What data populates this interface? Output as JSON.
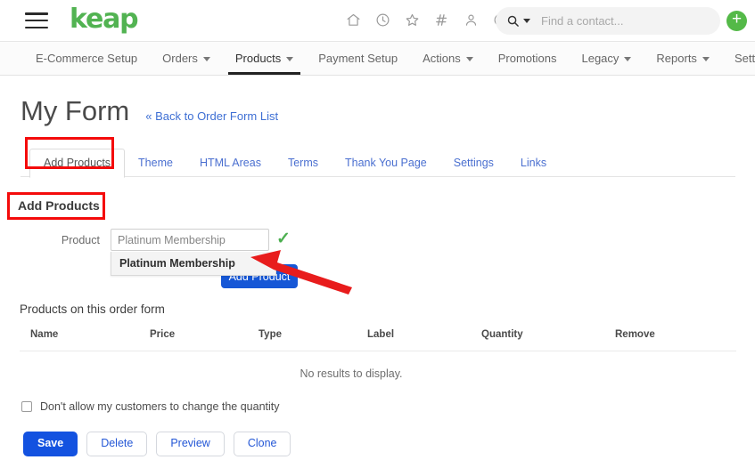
{
  "header": {
    "brand": "keap",
    "menu_icon": "hamburger-icon",
    "icons": [
      {
        "name": "home-icon"
      },
      {
        "name": "history-clock-icon"
      },
      {
        "name": "favorites-star-icon"
      },
      {
        "name": "shortcuts-icon"
      },
      {
        "name": "contacts-person-icon"
      },
      {
        "name": "help-question-icon"
      }
    ],
    "search": {
      "placeholder": "Find a contact...",
      "value": "",
      "icon": "search-icon",
      "dropdown_icon": "caret-down-icon"
    },
    "add_button": {
      "label": "+",
      "color": "#54b948"
    }
  },
  "nav": {
    "items": [
      {
        "label": "E-Commerce Setup",
        "has_caret": false,
        "active": false
      },
      {
        "label": "Orders",
        "has_caret": true,
        "active": false
      },
      {
        "label": "Products",
        "has_caret": true,
        "active": true
      },
      {
        "label": "Payment Setup",
        "has_caret": false,
        "active": false
      },
      {
        "label": "Actions",
        "has_caret": true,
        "active": false
      },
      {
        "label": "Promotions",
        "has_caret": false,
        "active": false
      },
      {
        "label": "Legacy",
        "has_caret": true,
        "active": false
      },
      {
        "label": "Reports",
        "has_caret": true,
        "active": false
      },
      {
        "label": "Settings",
        "has_caret": false,
        "active": false
      }
    ]
  },
  "page": {
    "title": "My Form",
    "back_link": "« Back to Order Form List"
  },
  "tabs": [
    {
      "label": "Add Products",
      "active": true
    },
    {
      "label": "Theme",
      "active": false
    },
    {
      "label": "HTML Areas",
      "active": false
    },
    {
      "label": "Terms",
      "active": false
    },
    {
      "label": "Thank You Page",
      "active": false
    },
    {
      "label": "Settings",
      "active": false
    },
    {
      "label": "Links",
      "active": false
    }
  ],
  "add_products": {
    "section_title": "Add Products",
    "product_label": "Product",
    "product_value": "Platinum Membership",
    "product_placeholder": "Platinum Membership",
    "validation_icon": "green-check-icon",
    "add_button_label": "Add Product",
    "dropdown_options": [
      "Platinum Membership"
    ]
  },
  "products_table": {
    "title": "Products on this order form",
    "columns": [
      "Name",
      "Price",
      "Type",
      "Label",
      "Quantity",
      "Remove"
    ],
    "rows": [],
    "empty_message": "No results to display."
  },
  "footer": {
    "quantity_checkbox_label": "Don't allow my customers to change the quantity",
    "quantity_checkbox_checked": false,
    "buttons": [
      {
        "label": "Save",
        "style": "primary"
      },
      {
        "label": "Delete",
        "style": "secondary"
      },
      {
        "label": "Preview",
        "style": "secondary"
      },
      {
        "label": "Clone",
        "style": "secondary"
      }
    ]
  },
  "annotations": {
    "box_color": "#f40b0b",
    "arrow_color": "#e81c1c",
    "highlight_tab": "Add Products",
    "highlight_section": "Add Products"
  }
}
